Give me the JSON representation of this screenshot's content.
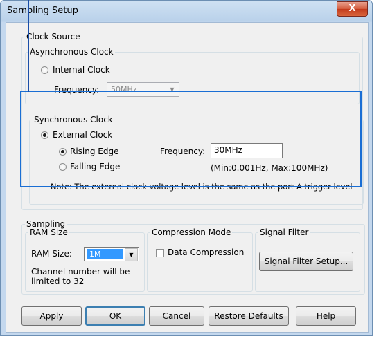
{
  "window": {
    "title": "Sampling Setup",
    "close_glyph": "X"
  },
  "clock_source": {
    "legend": "Clock Source",
    "asynchronous": {
      "legend": "Asynchronous Clock",
      "internal_clock_label": "Internal Clock",
      "internal_clock_selected": false,
      "frequency_label": "Frequency:",
      "frequency_value": "50MHz"
    },
    "synchronous": {
      "legend": "Synchronous Clock",
      "external_clock_label": "External Clock",
      "external_clock_selected": true,
      "rising_edge_label": "Rising Edge",
      "rising_edge_selected": true,
      "falling_edge_label": "Falling Edge",
      "falling_edge_selected": false,
      "frequency_label": "Frequency:",
      "frequency_value": "30MHz",
      "range_note": "(Min:0.001Hz, Max:100MHz)",
      "note": "Note: The external clock voltage level is the same as the port A trigger level"
    }
  },
  "sampling": {
    "legend": "Sampling",
    "ram": {
      "legend": "RAM Size",
      "label": "RAM Size:",
      "value": "1M",
      "note_line1": "Channel number will be",
      "note_line2": "limited to 32"
    },
    "compression": {
      "legend": "Compression Mode",
      "checkbox_label": "Data Compression",
      "checked": false
    },
    "signal_filter": {
      "legend": "Signal Filter",
      "button_label": "Signal Filter Setup..."
    }
  },
  "buttons": {
    "apply": "Apply",
    "ok": "OK",
    "cancel": "Cancel",
    "restore_defaults": "Restore Defaults",
    "help": "Help"
  },
  "colors": {
    "focus_highlight": "#1a6ed4",
    "close_button": "#c8452a",
    "selection": "#3399ff"
  }
}
